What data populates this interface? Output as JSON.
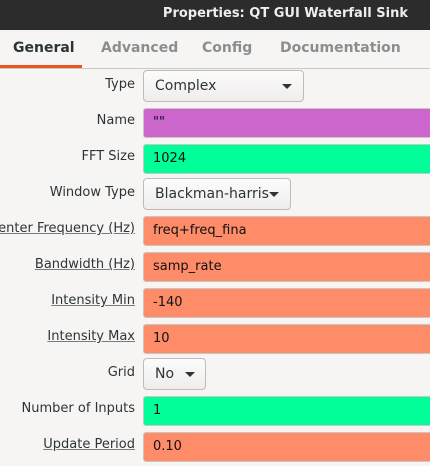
{
  "window": {
    "title": "Properties: QT GUI Waterfall Sink"
  },
  "tabs": [
    {
      "label": "General"
    },
    {
      "label": "Advanced"
    },
    {
      "label": "Config"
    },
    {
      "label": "Documentation"
    }
  ],
  "colors": {
    "expression": "#ff8c69",
    "int": "#00ff99",
    "string": "#cc66cc",
    "active_tab": "#e95420"
  },
  "properties": {
    "type": {
      "label": "Type",
      "value": "Complex"
    },
    "name": {
      "label": "Name",
      "value": "\"\""
    },
    "fft_size": {
      "label": "FFT Size",
      "value": "1024"
    },
    "window_type": {
      "label": "Window Type",
      "value": "Blackman-harris"
    },
    "center_freq": {
      "label": "Center Frequency (Hz)",
      "value": "freq+freq_fina"
    },
    "bandwidth": {
      "label": "Bandwidth (Hz)",
      "value": "samp_rate"
    },
    "intensity_min": {
      "label": "Intensity Min",
      "value": "-140"
    },
    "intensity_max": {
      "label": "Intensity Max",
      "value": "10"
    },
    "grid": {
      "label": "Grid",
      "value": "No"
    },
    "num_inputs": {
      "label": "Number of Inputs",
      "value": "1"
    },
    "update_period": {
      "label": "Update Period",
      "value": "0.10"
    }
  }
}
